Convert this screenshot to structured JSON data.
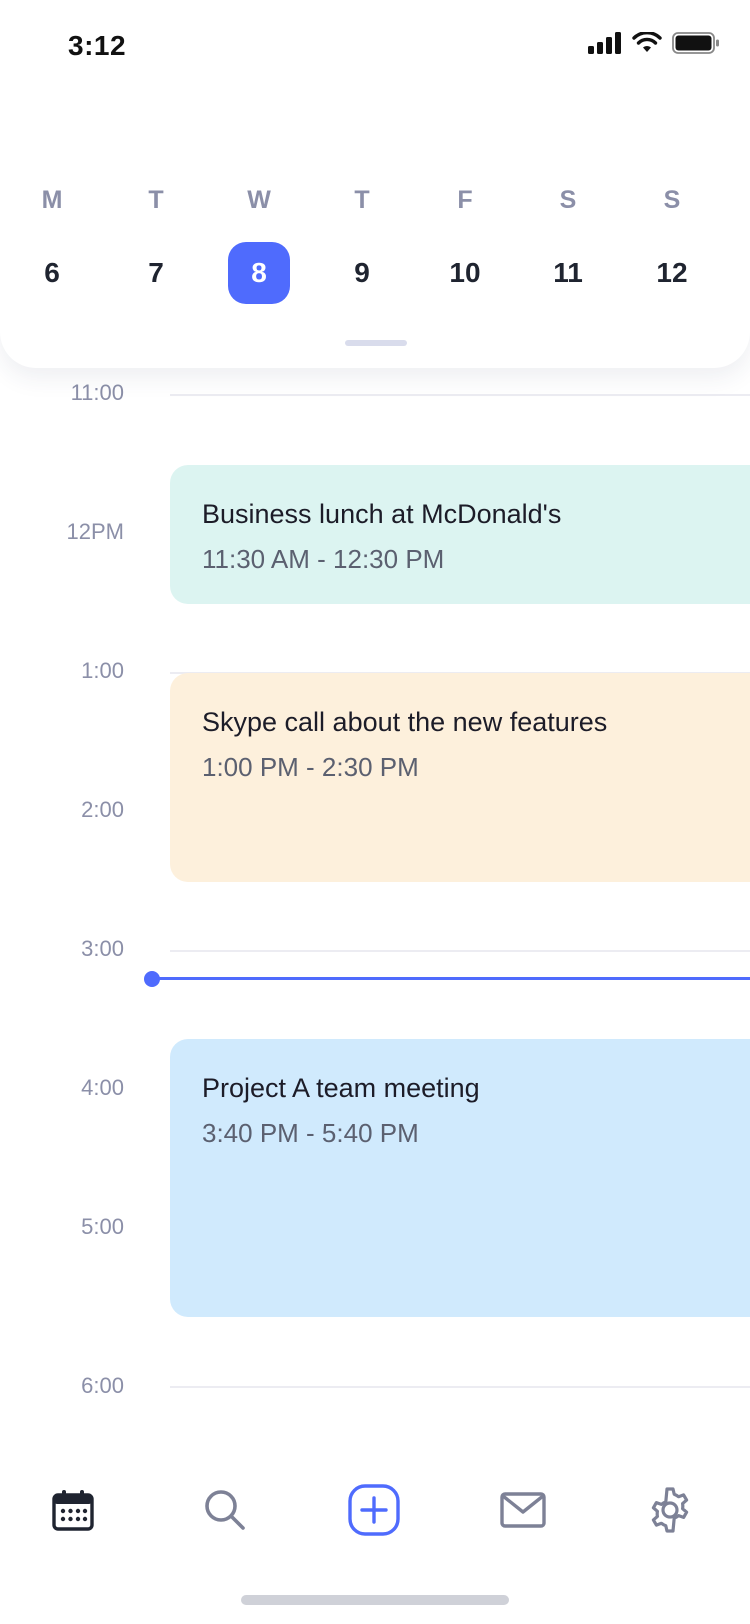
{
  "status_bar": {
    "time": "3:12"
  },
  "week": {
    "days": [
      {
        "letter": "M",
        "date": "6",
        "selected": false
      },
      {
        "letter": "T",
        "date": "7",
        "selected": false
      },
      {
        "letter": "W",
        "date": "8",
        "selected": true
      },
      {
        "letter": "T",
        "date": "9",
        "selected": false
      },
      {
        "letter": "F",
        "date": "10",
        "selected": false
      },
      {
        "letter": "S",
        "date": "11",
        "selected": false
      },
      {
        "letter": "S",
        "date": "12",
        "selected": false
      }
    ]
  },
  "timeline": {
    "hours": [
      "11:00",
      "12PM",
      "1:00",
      "2:00",
      "3:00",
      "4:00",
      "5:00",
      "6:00"
    ],
    "events": [
      {
        "title": "Business lunch at McDonald's",
        "time": "11:30 AM - 12:30 PM",
        "color": "#dcf4f1"
      },
      {
        "title": "Skype call about the new features",
        "time": "1:00 PM - 2:30 PM",
        "color": "#fdf0dc"
      },
      {
        "title": "Project A team meeting",
        "time": "3:40 PM - 5:40 PM",
        "color": "#d0eafd"
      }
    ]
  },
  "bottom_nav": {
    "items": [
      {
        "icon": "calendar-icon",
        "active": true
      },
      {
        "icon": "search-icon",
        "active": false
      },
      {
        "icon": "add-icon",
        "active": false
      },
      {
        "icon": "mail-icon",
        "active": false
      },
      {
        "icon": "settings-icon",
        "active": false
      }
    ]
  },
  "colors": {
    "accent": "#4f6bfd",
    "muted": "#8b8fa8"
  }
}
